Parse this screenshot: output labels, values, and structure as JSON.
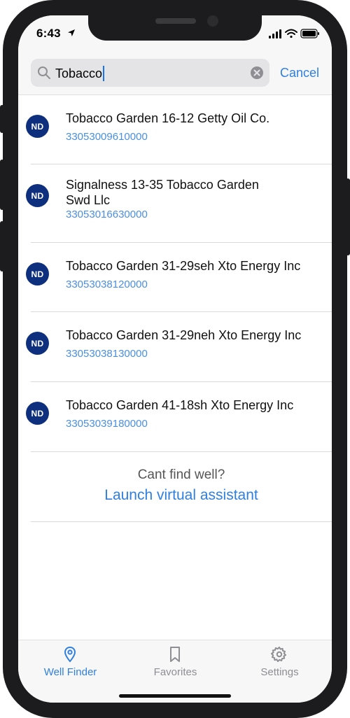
{
  "status_bar": {
    "time": "6:43"
  },
  "search": {
    "value": "Tobacco",
    "cancel_label": "Cancel"
  },
  "badge_text": "ND",
  "results": [
    {
      "title": "Tobacco Garden 16-12 Getty Oil Co.",
      "api": "33053009610000"
    },
    {
      "title": "Signalness 13-35 Tobacco Garden Swd Llc",
      "api": "33053016630000"
    },
    {
      "title": "Tobacco Garden 31-29seh Xto Energy Inc",
      "api": "33053038120000"
    },
    {
      "title": "Tobacco Garden 31-29neh Xto Energy Inc",
      "api": "33053038130000"
    },
    {
      "title": "Tobacco Garden 41-18sh Xto Energy Inc",
      "api": "33053039180000"
    }
  ],
  "footer": {
    "prompt": "Cant find well?",
    "link": "Launch virtual assistant"
  },
  "tabs": [
    {
      "label": "Well Finder",
      "icon": "map-pin-icon",
      "active": true
    },
    {
      "label": "Favorites",
      "icon": "bookmark-icon",
      "active": false
    },
    {
      "label": "Settings",
      "icon": "gear-icon",
      "active": false
    }
  ],
  "colors": {
    "accent": "#2f7fe0",
    "badge": "#0d2f7e",
    "api_text": "#4a8fe0",
    "inactive_tab": "#8e8e93"
  }
}
